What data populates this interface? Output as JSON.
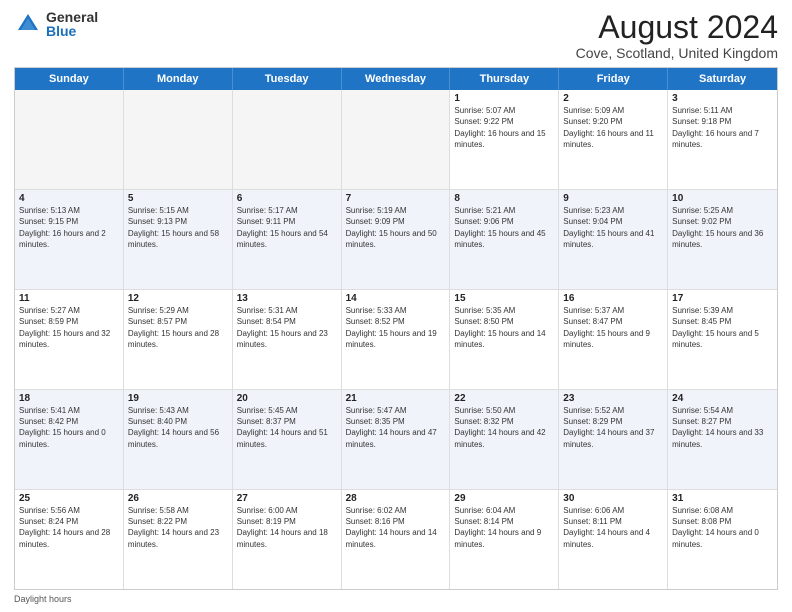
{
  "logo": {
    "general": "General",
    "blue": "Blue"
  },
  "title": "August 2024",
  "location": "Cove, Scotland, United Kingdom",
  "days_of_week": [
    "Sunday",
    "Monday",
    "Tuesday",
    "Wednesday",
    "Thursday",
    "Friday",
    "Saturday"
  ],
  "footer_label": "Daylight hours",
  "weeks": [
    [
      {
        "day": "",
        "sunrise": "",
        "sunset": "",
        "daylight": "",
        "empty": true
      },
      {
        "day": "",
        "sunrise": "",
        "sunset": "",
        "daylight": "",
        "empty": true
      },
      {
        "day": "",
        "sunrise": "",
        "sunset": "",
        "daylight": "",
        "empty": true
      },
      {
        "day": "",
        "sunrise": "",
        "sunset": "",
        "daylight": "",
        "empty": true
      },
      {
        "day": "1",
        "sunrise": "Sunrise: 5:07 AM",
        "sunset": "Sunset: 9:22 PM",
        "daylight": "Daylight: 16 hours and 15 minutes."
      },
      {
        "day": "2",
        "sunrise": "Sunrise: 5:09 AM",
        "sunset": "Sunset: 9:20 PM",
        "daylight": "Daylight: 16 hours and 11 minutes."
      },
      {
        "day": "3",
        "sunrise": "Sunrise: 5:11 AM",
        "sunset": "Sunset: 9:18 PM",
        "daylight": "Daylight: 16 hours and 7 minutes."
      }
    ],
    [
      {
        "day": "4",
        "sunrise": "Sunrise: 5:13 AM",
        "sunset": "Sunset: 9:15 PM",
        "daylight": "Daylight: 16 hours and 2 minutes."
      },
      {
        "day": "5",
        "sunrise": "Sunrise: 5:15 AM",
        "sunset": "Sunset: 9:13 PM",
        "daylight": "Daylight: 15 hours and 58 minutes."
      },
      {
        "day": "6",
        "sunrise": "Sunrise: 5:17 AM",
        "sunset": "Sunset: 9:11 PM",
        "daylight": "Daylight: 15 hours and 54 minutes."
      },
      {
        "day": "7",
        "sunrise": "Sunrise: 5:19 AM",
        "sunset": "Sunset: 9:09 PM",
        "daylight": "Daylight: 15 hours and 50 minutes."
      },
      {
        "day": "8",
        "sunrise": "Sunrise: 5:21 AM",
        "sunset": "Sunset: 9:06 PM",
        "daylight": "Daylight: 15 hours and 45 minutes."
      },
      {
        "day": "9",
        "sunrise": "Sunrise: 5:23 AM",
        "sunset": "Sunset: 9:04 PM",
        "daylight": "Daylight: 15 hours and 41 minutes."
      },
      {
        "day": "10",
        "sunrise": "Sunrise: 5:25 AM",
        "sunset": "Sunset: 9:02 PM",
        "daylight": "Daylight: 15 hours and 36 minutes."
      }
    ],
    [
      {
        "day": "11",
        "sunrise": "Sunrise: 5:27 AM",
        "sunset": "Sunset: 8:59 PM",
        "daylight": "Daylight: 15 hours and 32 minutes."
      },
      {
        "day": "12",
        "sunrise": "Sunrise: 5:29 AM",
        "sunset": "Sunset: 8:57 PM",
        "daylight": "Daylight: 15 hours and 28 minutes."
      },
      {
        "day": "13",
        "sunrise": "Sunrise: 5:31 AM",
        "sunset": "Sunset: 8:54 PM",
        "daylight": "Daylight: 15 hours and 23 minutes."
      },
      {
        "day": "14",
        "sunrise": "Sunrise: 5:33 AM",
        "sunset": "Sunset: 8:52 PM",
        "daylight": "Daylight: 15 hours and 19 minutes."
      },
      {
        "day": "15",
        "sunrise": "Sunrise: 5:35 AM",
        "sunset": "Sunset: 8:50 PM",
        "daylight": "Daylight: 15 hours and 14 minutes."
      },
      {
        "day": "16",
        "sunrise": "Sunrise: 5:37 AM",
        "sunset": "Sunset: 8:47 PM",
        "daylight": "Daylight: 15 hours and 9 minutes."
      },
      {
        "day": "17",
        "sunrise": "Sunrise: 5:39 AM",
        "sunset": "Sunset: 8:45 PM",
        "daylight": "Daylight: 15 hours and 5 minutes."
      }
    ],
    [
      {
        "day": "18",
        "sunrise": "Sunrise: 5:41 AM",
        "sunset": "Sunset: 8:42 PM",
        "daylight": "Daylight: 15 hours and 0 minutes."
      },
      {
        "day": "19",
        "sunrise": "Sunrise: 5:43 AM",
        "sunset": "Sunset: 8:40 PM",
        "daylight": "Daylight: 14 hours and 56 minutes."
      },
      {
        "day": "20",
        "sunrise": "Sunrise: 5:45 AM",
        "sunset": "Sunset: 8:37 PM",
        "daylight": "Daylight: 14 hours and 51 minutes."
      },
      {
        "day": "21",
        "sunrise": "Sunrise: 5:47 AM",
        "sunset": "Sunset: 8:35 PM",
        "daylight": "Daylight: 14 hours and 47 minutes."
      },
      {
        "day": "22",
        "sunrise": "Sunrise: 5:50 AM",
        "sunset": "Sunset: 8:32 PM",
        "daylight": "Daylight: 14 hours and 42 minutes."
      },
      {
        "day": "23",
        "sunrise": "Sunrise: 5:52 AM",
        "sunset": "Sunset: 8:29 PM",
        "daylight": "Daylight: 14 hours and 37 minutes."
      },
      {
        "day": "24",
        "sunrise": "Sunrise: 5:54 AM",
        "sunset": "Sunset: 8:27 PM",
        "daylight": "Daylight: 14 hours and 33 minutes."
      }
    ],
    [
      {
        "day": "25",
        "sunrise": "Sunrise: 5:56 AM",
        "sunset": "Sunset: 8:24 PM",
        "daylight": "Daylight: 14 hours and 28 minutes."
      },
      {
        "day": "26",
        "sunrise": "Sunrise: 5:58 AM",
        "sunset": "Sunset: 8:22 PM",
        "daylight": "Daylight: 14 hours and 23 minutes."
      },
      {
        "day": "27",
        "sunrise": "Sunrise: 6:00 AM",
        "sunset": "Sunset: 8:19 PM",
        "daylight": "Daylight: 14 hours and 18 minutes."
      },
      {
        "day": "28",
        "sunrise": "Sunrise: 6:02 AM",
        "sunset": "Sunset: 8:16 PM",
        "daylight": "Daylight: 14 hours and 14 minutes."
      },
      {
        "day": "29",
        "sunrise": "Sunrise: 6:04 AM",
        "sunset": "Sunset: 8:14 PM",
        "daylight": "Daylight: 14 hours and 9 minutes."
      },
      {
        "day": "30",
        "sunrise": "Sunrise: 6:06 AM",
        "sunset": "Sunset: 8:11 PM",
        "daylight": "Daylight: 14 hours and 4 minutes."
      },
      {
        "day": "31",
        "sunrise": "Sunrise: 6:08 AM",
        "sunset": "Sunset: 8:08 PM",
        "daylight": "Daylight: 14 hours and 0 minutes."
      }
    ]
  ]
}
